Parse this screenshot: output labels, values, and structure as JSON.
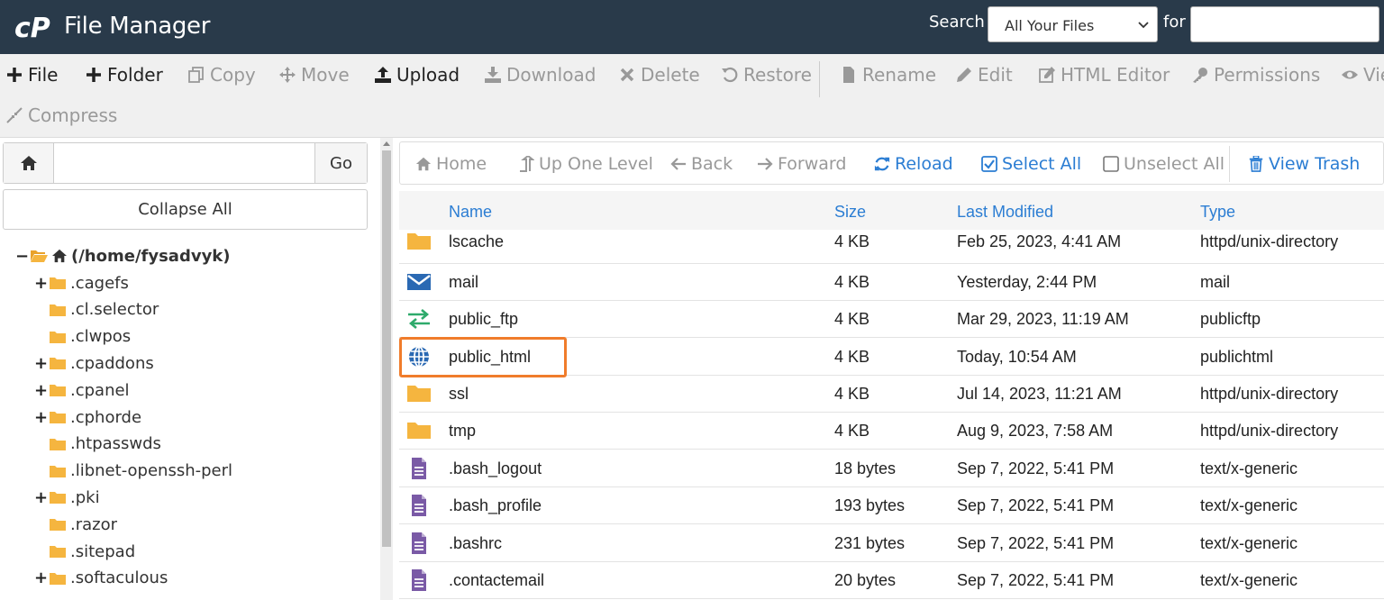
{
  "header": {
    "title": "File Manager",
    "search_label": "Search",
    "search_scope": "All Your Files",
    "for_label": "for",
    "search_value": ""
  },
  "toolbar": {
    "items": [
      {
        "label": "File",
        "icon": "plus-icon",
        "enabled": true
      },
      {
        "label": "Folder",
        "icon": "plus-icon",
        "enabled": true
      },
      {
        "label": "Copy",
        "icon": "copy-icon",
        "enabled": false
      },
      {
        "label": "Move",
        "icon": "move-icon",
        "enabled": false
      },
      {
        "label": "Upload",
        "icon": "upload-icon",
        "enabled": true
      },
      {
        "label": "Download",
        "icon": "download-icon",
        "enabled": false
      },
      {
        "label": "Delete",
        "icon": "delete-icon",
        "enabled": false
      },
      {
        "label": "Restore",
        "icon": "restore-icon",
        "enabled": false
      },
      {
        "label": "Rename",
        "icon": "file-icon",
        "enabled": false
      },
      {
        "label": "Edit",
        "icon": "pencil-icon",
        "enabled": false
      },
      {
        "label": "HTML Editor",
        "icon": "edit-square-icon",
        "enabled": false
      },
      {
        "label": "Permissions",
        "icon": "key-icon",
        "enabled": false
      },
      {
        "label": "Vie",
        "icon": "eye-icon",
        "enabled": false
      },
      {
        "label": "Compress",
        "icon": "compress-icon",
        "enabled": false
      }
    ]
  },
  "tree_panel": {
    "go_label": "Go",
    "path_value": "",
    "collapse_label": "Collapse All",
    "root": "(/home/fysadvyk)",
    "items": [
      {
        "label": ".cagefs",
        "expandable": true
      },
      {
        "label": ".cl.selector",
        "expandable": false
      },
      {
        "label": ".clwpos",
        "expandable": false
      },
      {
        "label": ".cpaddons",
        "expandable": true
      },
      {
        "label": ".cpanel",
        "expandable": true
      },
      {
        "label": ".cphorde",
        "expandable": true
      },
      {
        "label": ".htpasswds",
        "expandable": false
      },
      {
        "label": ".libnet-openssh-perl",
        "expandable": false
      },
      {
        "label": ".pki",
        "expandable": true
      },
      {
        "label": ".razor",
        "expandable": false
      },
      {
        "label": ".sitepad",
        "expandable": false
      },
      {
        "label": ".softaculous",
        "expandable": true
      }
    ]
  },
  "nav": {
    "home": "Home",
    "up": "Up One Level",
    "back": "Back",
    "forward": "Forward",
    "reload": "Reload",
    "select_all": "Select All",
    "unselect_all": "Unselect All",
    "view_trash": "View Trash"
  },
  "table": {
    "columns": [
      "Name",
      "Size",
      "Last Modified",
      "Type"
    ],
    "rows": [
      {
        "icon": "folder-icon",
        "name": "lscache",
        "size": "4 KB",
        "modified": "Feb 25, 2023, 4:41 AM",
        "type": "httpd/unix-directory"
      },
      {
        "icon": "mail-icon",
        "name": "mail",
        "size": "4 KB",
        "modified": "Yesterday, 2:44 PM",
        "type": "mail"
      },
      {
        "icon": "transfer-icon",
        "name": "public_ftp",
        "size": "4 KB",
        "modified": "Mar 29, 2023, 11:19 AM",
        "type": "publicftp"
      },
      {
        "icon": "globe-icon",
        "name": "public_html",
        "size": "4 KB",
        "modified": "Today, 10:54 AM",
        "type": "publichtml"
      },
      {
        "icon": "folder-icon",
        "name": "ssl",
        "size": "4 KB",
        "modified": "Jul 14, 2023, 11:21 AM",
        "type": "httpd/unix-directory"
      },
      {
        "icon": "folder-icon",
        "name": "tmp",
        "size": "4 KB",
        "modified": "Aug 9, 2023, 7:58 AM",
        "type": "httpd/unix-directory"
      },
      {
        "icon": "text-file-icon",
        "name": ".bash_logout",
        "size": "18 bytes",
        "modified": "Sep 7, 2022, 5:41 PM",
        "type": "text/x-generic"
      },
      {
        "icon": "text-file-icon",
        "name": ".bash_profile",
        "size": "193 bytes",
        "modified": "Sep 7, 2022, 5:41 PM",
        "type": "text/x-generic"
      },
      {
        "icon": "text-file-icon",
        "name": ".bashrc",
        "size": "231 bytes",
        "modified": "Sep 7, 2022, 5:41 PM",
        "type": "text/x-generic"
      },
      {
        "icon": "text-file-icon",
        "name": ".contactemail",
        "size": "20 bytes",
        "modified": "Sep 7, 2022, 5:41 PM",
        "type": "text/x-generic"
      }
    ]
  },
  "colors": {
    "header_bg": "#293a4a",
    "accent_blue": "#2b7dd3",
    "folder": "#f5b53f",
    "highlight": "#f07c2b",
    "file_purple": "#7a5aa6",
    "ftp_green": "#2eaa6b"
  }
}
